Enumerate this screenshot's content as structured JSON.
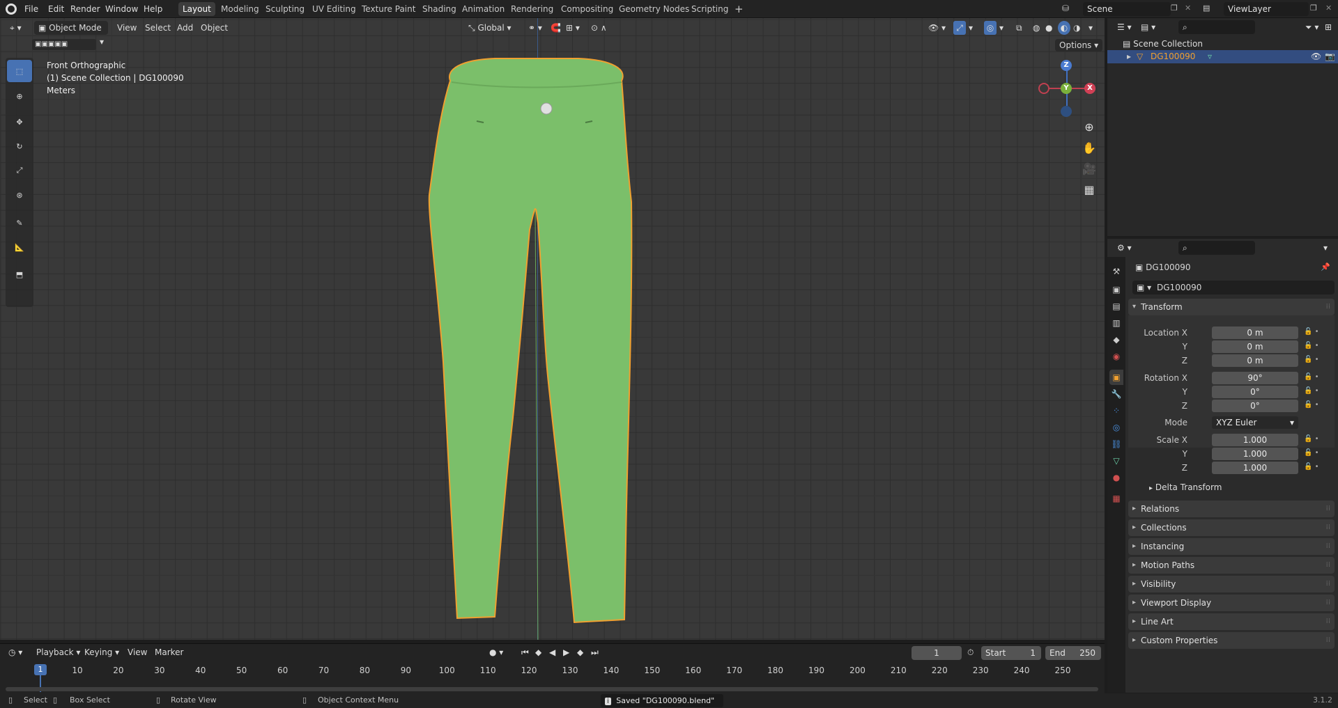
{
  "topbar": {
    "menus": [
      "File",
      "Edit",
      "Render",
      "Window",
      "Help"
    ],
    "workspaces": [
      "Layout",
      "Modeling",
      "Sculpting",
      "UV Editing",
      "Texture Paint",
      "Shading",
      "Animation",
      "Rendering",
      "Compositing",
      "Geometry Nodes",
      "Scripting"
    ],
    "add_tab": "+",
    "scene": "Scene",
    "view_layer": "ViewLayer"
  },
  "viewport": {
    "mode": "Object Mode",
    "menus": [
      "View",
      "Select",
      "Add",
      "Object"
    ],
    "orientation": "Global",
    "options_label": "Options",
    "overlay_view": "Front Orthographic",
    "overlay_collection": "(1) Scene Collection | DG100090",
    "overlay_units": "Meters",
    "gizmo": {
      "z": "Z",
      "y": "Y",
      "x": "X"
    },
    "object_color": "#7bbf6a",
    "outline_color": "#f0a030"
  },
  "outliner": {
    "root": "Scene Collection",
    "item": "DG100090"
  },
  "properties": {
    "object_name": "DG100090",
    "data_name": "DG100090",
    "transform_label": "Transform",
    "location_label": "Location X",
    "location": {
      "x": "0 m",
      "y": "0 m",
      "z": "0 m"
    },
    "rotation_label": "Rotation X",
    "rotation": {
      "x": "90°",
      "y": "0°",
      "z": "0°"
    },
    "mode_label": "Mode",
    "mode_value": "XYZ Euler",
    "scale_label": "Scale X",
    "scale": {
      "x": "1.000",
      "y": "1.000",
      "z": "1.000"
    },
    "axis_y": "Y",
    "axis_z": "Z",
    "delta_transform": "Delta Transform",
    "panels": [
      "Relations",
      "Collections",
      "Instancing",
      "Motion Paths",
      "Visibility",
      "Viewport Display",
      "Line Art",
      "Custom Properties"
    ]
  },
  "timeline": {
    "menus": [
      "Playback",
      "Keying",
      "View",
      "Marker"
    ],
    "current_frame": "1",
    "start_label": "Start",
    "start": "1",
    "end_label": "End",
    "end": "250",
    "ticks": [
      "1",
      "10",
      "20",
      "30",
      "40",
      "50",
      "60",
      "70",
      "80",
      "90",
      "100",
      "110",
      "120",
      "130",
      "140",
      "150",
      "160",
      "170",
      "180",
      "190",
      "200",
      "210",
      "220",
      "230",
      "240",
      "250"
    ]
  },
  "statusbar": {
    "select": "Select",
    "box_select": "Box Select",
    "rotate_view": "Rotate View",
    "context_menu": "Object Context Menu",
    "message": "Saved \"DG100090.blend\"",
    "version": "3.1.2"
  }
}
